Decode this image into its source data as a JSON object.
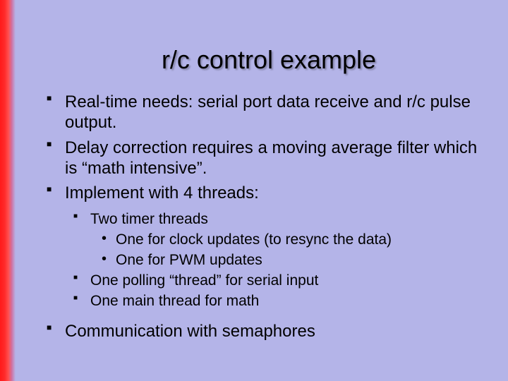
{
  "slide": {
    "title": "r/c control example",
    "bullets": {
      "b1": "Real-time needs: serial port data receive and r/c pulse output.",
      "b2": "Delay correction requires a moving average filter which is “math intensive”.",
      "b3": "Implement with 4 threads:",
      "b3_children": {
        "c1": "Two timer threads",
        "c1_children": {
          "d1": "One for clock updates (to resync the data)",
          "d2": "One for PWM updates"
        },
        "c2": "One polling “thread” for serial input",
        "c3": "One main thread for math"
      },
      "b4": "Communication with semaphores"
    }
  }
}
